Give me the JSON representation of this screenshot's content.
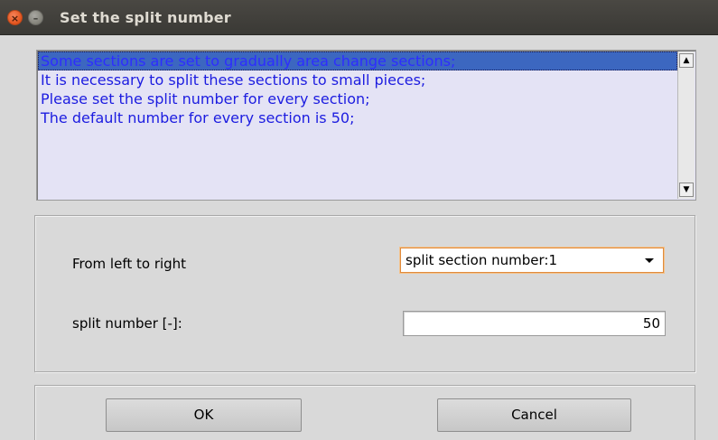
{
  "window": {
    "title": "Set the split number",
    "close_symbol": "×",
    "minimize_symbol": "–"
  },
  "info_list": {
    "lines": [
      "Some sections are set to gradually area change sections;",
      "It is necessary to split these sections to small pieces;",
      "Please set the split number for every section;",
      "The default number for every section is 50;"
    ],
    "selected_index": 0,
    "scroll_up_symbol": "▲",
    "scroll_down_symbol": "▼"
  },
  "form": {
    "from_label": "From left to right",
    "section_select_value": "split section number:1",
    "split_label": "split number [-]:",
    "split_value": "50"
  },
  "buttons": {
    "ok_label": "OK",
    "cancel_label": "Cancel"
  },
  "colors": {
    "titlebar": "#3c3b37",
    "close_button": "#e9622a",
    "list_background": "#e4e3f5",
    "list_text": "#1c1ce0",
    "selected_row": "#3c67c0",
    "focus_outline": "#e08b3c"
  }
}
